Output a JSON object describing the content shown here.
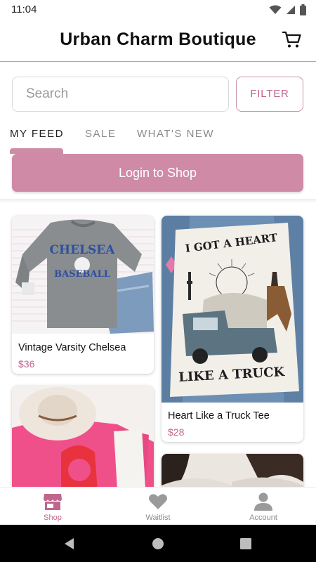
{
  "status_bar": {
    "time": "11:04"
  },
  "header": {
    "title": "Urban Charm Boutique"
  },
  "search": {
    "placeholder": "Search",
    "filter_label": "FILTER"
  },
  "tabs": [
    {
      "label": "MY FEED",
      "active": true
    },
    {
      "label": "SALE",
      "active": false
    },
    {
      "label": "WHAT'S NEW",
      "active": false
    }
  ],
  "login": {
    "label": "Login to Shop"
  },
  "products": [
    {
      "title": "Vintage Varsity Chelsea",
      "price": "$36",
      "print_lines": [
        "CHELSEA",
        "BASEBALL"
      ]
    },
    {
      "title": "Heart Like a Truck Tee",
      "price": "$28",
      "print_lines": [
        "I GOT A HEART",
        "LIKE A TRUCK"
      ]
    },
    {
      "title": "",
      "price": ""
    },
    {
      "title": "",
      "price": ""
    }
  ],
  "bottom_nav": [
    {
      "label": "Shop",
      "icon": "store-icon",
      "active": true
    },
    {
      "label": "Waitlist",
      "icon": "heart-icon",
      "active": false
    },
    {
      "label": "Account",
      "icon": "person-icon",
      "active": false
    }
  ],
  "colors": {
    "accent": "#cf8aa6",
    "accent_text": "#c0668c",
    "header_border": "#c89aae"
  }
}
